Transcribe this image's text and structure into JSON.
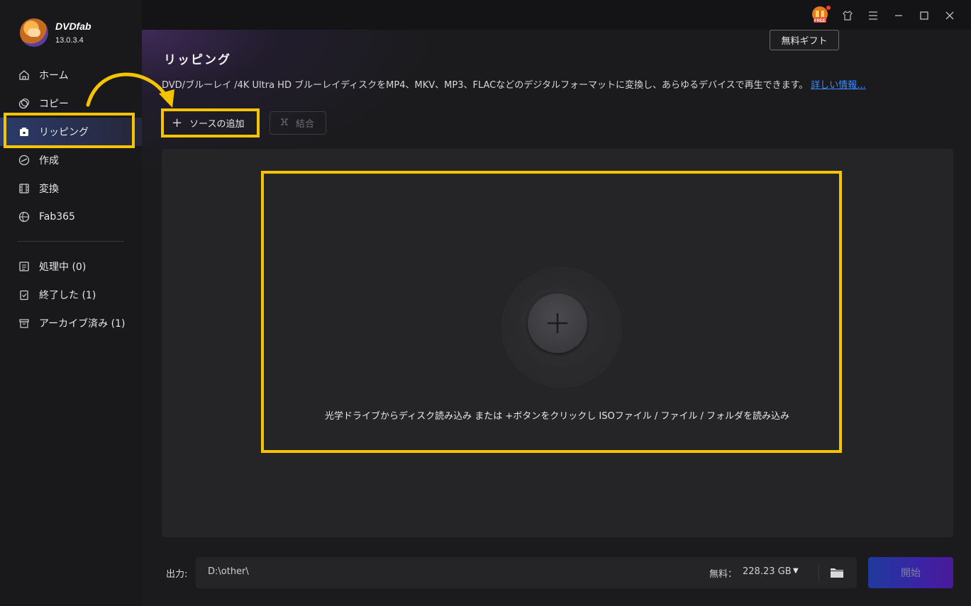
{
  "app": {
    "brand": "DVDfab",
    "version": "13.0.3.4"
  },
  "sidebar": {
    "items": [
      {
        "label": "ホーム",
        "icon": "home-icon"
      },
      {
        "label": "コピー",
        "icon": "copy-icon"
      },
      {
        "label": "リッピング",
        "icon": "ripper-icon",
        "active": true
      },
      {
        "label": "作成",
        "icon": "creator-icon"
      },
      {
        "label": "変換",
        "icon": "converter-icon"
      },
      {
        "label": "Fab365",
        "icon": "fab365-icon"
      }
    ],
    "queue": [
      {
        "label": "処理中 (0)",
        "icon": "processing-icon"
      },
      {
        "label": "終了した (1)",
        "icon": "finished-icon"
      },
      {
        "label": "アーカイブ済み (1)",
        "icon": "archive-icon"
      }
    ]
  },
  "titlebar": {
    "gift_tooltip": "無料ギフト",
    "gift_badge": "FREE"
  },
  "main": {
    "title": "リッピング",
    "description": "DVD/ブルーレイ /4K Ultra HD ブルーレイディスクをMP4、MKV、MP3、FLACなどのデジタルフォーマットに変換し、あらゆるデバイスで再生できます。",
    "more_link": "詳しい情報...",
    "add_source": "ソースの追加",
    "merge": "結合",
    "drop_hint": "光学ドライブからディスク読み込み または +ボタンをクリックし ISOファイル / ファイル / フォルダを読み込み"
  },
  "output": {
    "label": "出力:",
    "path": "D:\\other\\",
    "free_label": "無料：",
    "free_value": "228.23 GB",
    "start": "開始"
  },
  "colors": {
    "highlight": "#f5c400",
    "link": "#3d8bff",
    "accent": "#2b3b6a"
  }
}
